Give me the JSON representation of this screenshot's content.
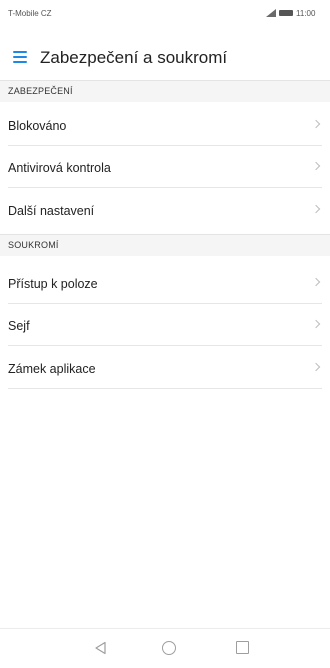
{
  "status_bar": {
    "carrier": "T-Mobile CZ",
    "time": "11:00"
  },
  "header": {
    "title": "Zabezpečení a soukromí"
  },
  "sections": [
    {
      "title": "ZABEZPEČENÍ",
      "items": [
        {
          "label": "Blokováno"
        },
        {
          "label": "Antivirová kontrola"
        },
        {
          "label": "Další nastavení"
        }
      ]
    },
    {
      "title": "SOUKROMÍ",
      "items": [
        {
          "label": "Přístup k poloze"
        },
        {
          "label": "Sejf"
        },
        {
          "label": "Zámek aplikace"
        }
      ]
    }
  ],
  "icons": {
    "menu": "hamburger-menu-icon",
    "chevron": "chevron-right-icon",
    "back": "back-triangle-icon",
    "home": "home-circle-icon",
    "recents": "recents-square-icon",
    "accent_color": "#1e88e5"
  }
}
